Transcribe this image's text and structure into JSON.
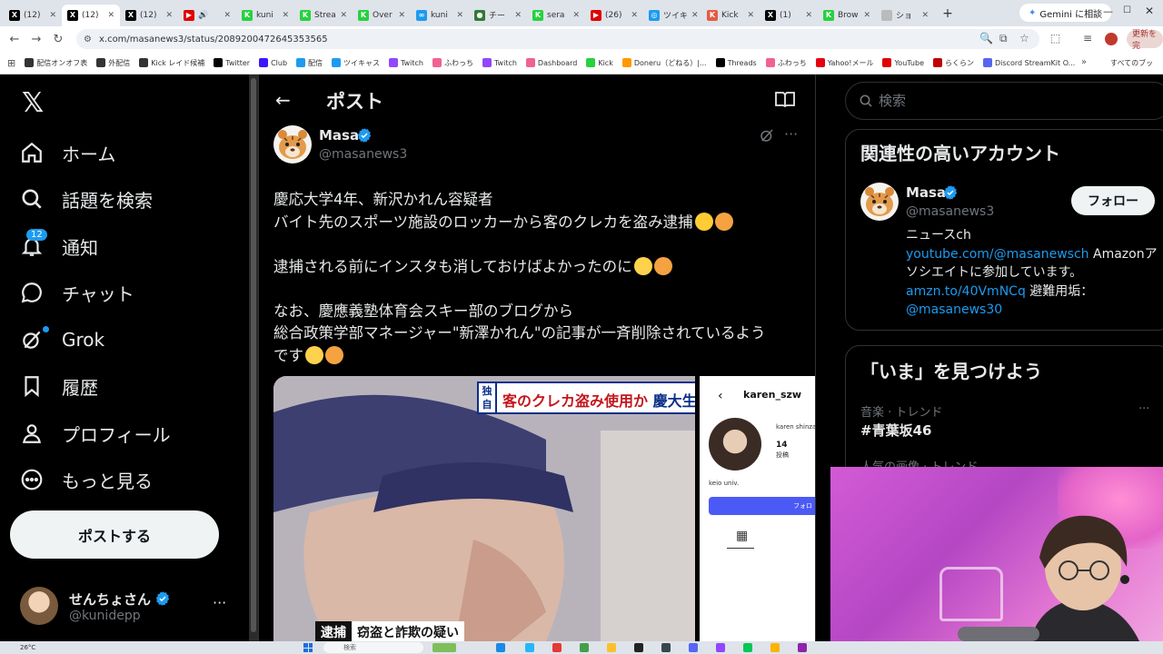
{
  "browser": {
    "tabs": [
      {
        "label": "(12)",
        "favicon": "x-favicon",
        "color": "#000000"
      },
      {
        "label": "(12)",
        "favicon": "x-favicon",
        "color": "#000000",
        "active": true
      },
      {
        "label": "(12)",
        "favicon": "x-favicon",
        "color": "#000000"
      },
      {
        "label": "",
        "favicon": "youtube-favicon",
        "color": "#e00000"
      },
      {
        "label": "kuni",
        "favicon": "kick-favicon",
        "color": "#27d13f"
      },
      {
        "label": "Strea",
        "favicon": "kick-favicon",
        "color": "#27d13f"
      },
      {
        "label": "Over",
        "favicon": "kick-favicon",
        "color": "#27d13f"
      },
      {
        "label": "kuni",
        "favicon": "loop-favicon",
        "color": "#1d9bf0"
      },
      {
        "label": "チー",
        "favicon": "generic-favicon",
        "color": "#2e7d32"
      },
      {
        "label": "sera",
        "favicon": "kick-favicon",
        "color": "#27d13f"
      },
      {
        "label": "(26)",
        "favicon": "youtube-favicon",
        "color": "#e00000"
      },
      {
        "label": "ツイキ",
        "favicon": "twicas-favicon",
        "color": "#1d9bf0"
      },
      {
        "label": "Kick",
        "favicon": "kick-favicon",
        "color": "#e25d44"
      },
      {
        "label": "(1)",
        "favicon": "x-favicon",
        "color": "#000000"
      },
      {
        "label": "Brow",
        "favicon": "kick-favicon",
        "color": "#27d13f"
      },
      {
        "label": "ショ",
        "favicon": "generic-favicon",
        "color": "#bbbbbb"
      }
    ],
    "gemini_label": "Gemini に相談",
    "url": "x.com/masanews3/status/2089200472645353565",
    "update_label": "更新を完",
    "bookmarks": [
      {
        "label": "配信オンオフ表",
        "color": "#333333"
      },
      {
        "label": "外配信",
        "color": "#333333"
      },
      {
        "label": "Kick レイド候補",
        "color": "#333333"
      },
      {
        "label": "Twitter",
        "color": "#000000"
      },
      {
        "label": "Club",
        "color": "#3b16ff"
      },
      {
        "label": "配信",
        "color": "#1d9bf0"
      },
      {
        "label": "ツイキャス",
        "color": "#1d9bf0"
      },
      {
        "label": "Twitch",
        "color": "#9146ff"
      },
      {
        "label": "ふわっち",
        "color": "#f06292"
      },
      {
        "label": "Twitch",
        "color": "#9146ff"
      },
      {
        "label": "Dashboard",
        "color": "#f06292"
      },
      {
        "label": "Kick",
        "color": "#27d13f"
      },
      {
        "label": "Doneru（どねる）|...",
        "color": "#ff9800"
      },
      {
        "label": "Threads",
        "color": "#000000"
      },
      {
        "label": "ふわっち",
        "color": "#f06292"
      },
      {
        "label": "Yahoo!メール",
        "color": "#e60012"
      },
      {
        "label": "YouTube",
        "color": "#e00000"
      },
      {
        "label": "らくらン",
        "color": "#bf0000"
      },
      {
        "label": "Discord StreamKit O...",
        "color": "#5865f2"
      }
    ],
    "bookmarks_all": "すべてのブッ"
  },
  "nav": {
    "items": [
      {
        "label": "ホーム",
        "icon": "home-icon"
      },
      {
        "label": "話題を検索",
        "icon": "search-icon"
      },
      {
        "label": "通知",
        "icon": "bell-icon"
      },
      {
        "label": "チャット",
        "icon": "chat-icon"
      },
      {
        "label": "Grok",
        "icon": "grok-icon"
      },
      {
        "label": "履歴",
        "icon": "bookmark-icon"
      },
      {
        "label": "プロフィール",
        "icon": "person-icon"
      },
      {
        "label": "もっと見る",
        "icon": "more-circle-icon"
      }
    ],
    "notification_count": "12",
    "post_button": "ポストする",
    "account": {
      "name": "せんちょさん",
      "handle": "@kunidepp"
    }
  },
  "post": {
    "header_title": "ポスト",
    "author": {
      "name": "Masa",
      "handle": "@masanews3"
    },
    "text_lines": [
      "慶応大学4年、新沢かれん容疑者",
      "バイト先のスポーツ施設のロッカーから客のクレカを盗み逮捕",
      "",
      "逮捕される前にインスタも消しておけばよかったのに",
      "",
      "なお、慶應義塾体育会スキー部のブログから",
      "総合政策学部マネージャー\"新澤かれん\"の記事が一斉削除されているよう",
      "です"
    ],
    "media": {
      "video_caption": {
        "exclusive": "独自",
        "headline": "客のクレカ盗み使用か",
        "headline_tail": "慶大生",
        "arrest": "逮捕",
        "charge": "窃盗と詐欺の疑い"
      },
      "instagram": {
        "username": "karen_szw",
        "display_name": "karen shinza",
        "posts_count": "14",
        "posts_label": "投稿",
        "bio": "keio univ.",
        "follow_label": "フォロ"
      }
    }
  },
  "sidebar": {
    "search_placeholder": "検索",
    "related_title": "関連性の高いアカウント",
    "related_account": {
      "name": "Masa",
      "handle": "@masanews3",
      "follow_label": "フォロー",
      "bio_text1": "ニュースch",
      "bio_link1": "youtube.com/@masanewsch",
      "bio_text2": " Amazonアソシエイトに参加しています。",
      "bio_link2": "amzn.to/40VmNCq",
      "bio_text3": " 避難用垢：",
      "bio_link3": "@masanews30"
    },
    "trends_title": "「いま」を見つけよう",
    "trends": [
      {
        "meta": "音楽 · トレンド",
        "name": "#青葉坂46"
      },
      {
        "meta": "人気の画像 · トレンド",
        "name": ""
      }
    ]
  },
  "taskbar": {
    "weather": "26°C",
    "search_placeholder": "検索"
  },
  "colors": {
    "accent": "#1d9bf0",
    "background": "#000000",
    "text_primary": "#e7e9ea",
    "text_secondary": "#71767b"
  }
}
